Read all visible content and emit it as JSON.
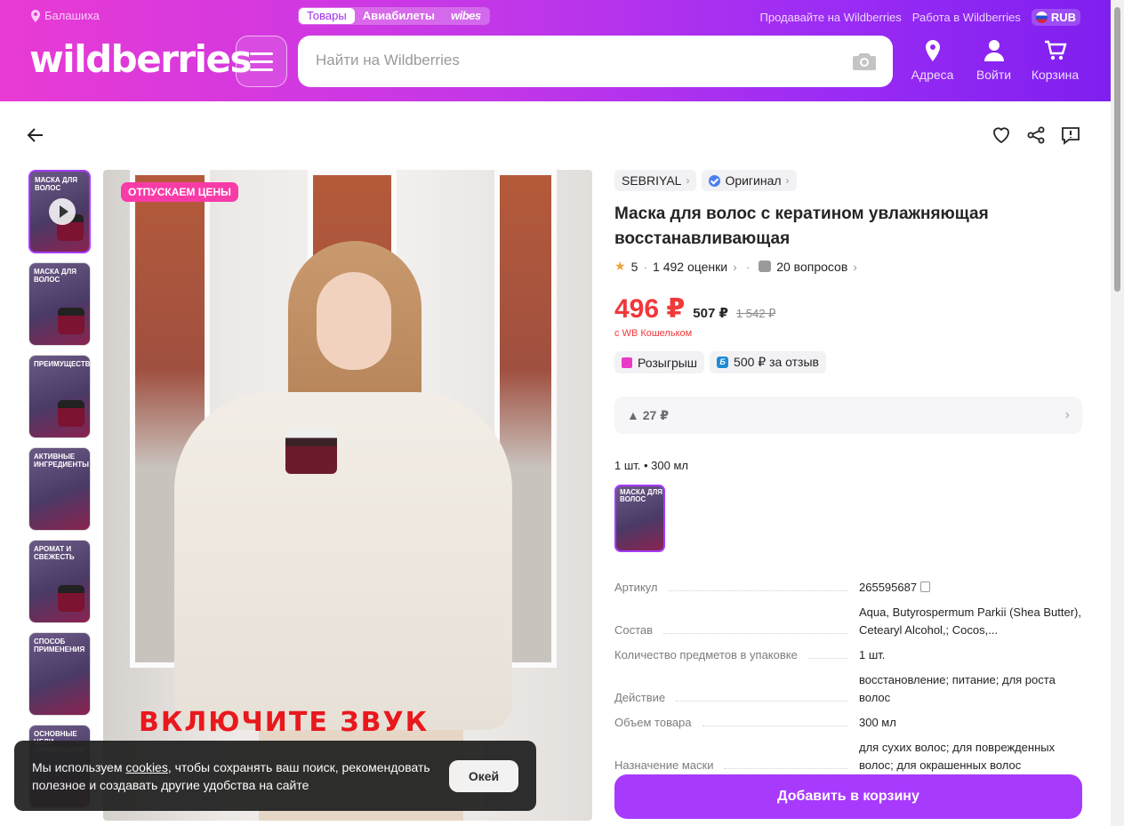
{
  "header": {
    "location": "Балашиха",
    "tabs": [
      "Товары",
      "Авиабилеты",
      "wibes"
    ],
    "sell_link": "Продавайте на Wildberries",
    "job_link": "Работа в Wildberries",
    "currency": "RUB",
    "logo": "wildberries",
    "search_placeholder": "Найти на Wildberries",
    "nav": {
      "addresses": "Адреса",
      "login": "Войти",
      "cart": "Корзина"
    }
  },
  "gallery": {
    "promo_label": "ОТПУСКАЕМ ЦЕНЫ",
    "sound_overlay": "ВКЛЮЧИТЕ ЗВУК",
    "thumbnails": [
      {
        "caption": "МАСКА ДЛЯ ВОЛОС",
        "video": true
      },
      {
        "caption": "МАСКА ДЛЯ ВОЛОС",
        "video": false
      },
      {
        "caption": "ПРЕИМУЩЕСТВА",
        "video": false
      },
      {
        "caption": "АКТИВНЫЕ ИНГРЕДИЕНТЫ",
        "video": false
      },
      {
        "caption": "АРОМАТ И СВЕЖЕСТЬ",
        "video": false
      },
      {
        "caption": "СПОСОБ ПРИМЕНЕНИЯ",
        "video": false
      },
      {
        "caption": "ОСНОВНЫЕ ЦЕЛИ ПРИМЕНЕНИЯ",
        "video": false
      }
    ]
  },
  "product": {
    "brand": "SEBRIYAL",
    "original": "Оригинал",
    "title": "Маска для волос с кератином увлажняющая восстанавливающая",
    "rating": "5",
    "reviews": "1 492 оценки",
    "questions": "20 вопросов",
    "price": "496 ₽",
    "price_no_wallet": "507 ₽",
    "old_price": "1 542 ₽",
    "wallet_note": "с WB Кошельком",
    "badge_lottery": "Розыгрыш",
    "badge_review": "500 ₽ за отзыв",
    "price_delta": "▲ 27 ₽",
    "pack_info": "1 шт. • 300 мл",
    "variant_caption": "МАСКА ДЛЯ ВОЛОС",
    "specs": [
      {
        "key": "Артикул",
        "value": "265595687"
      },
      {
        "key": "Состав",
        "value": "Aqua, Butyrospermum Parkii (Shea Butter), Cetearyl Alcohol,; Cocos,..."
      },
      {
        "key": "Количество предметов в упаковке",
        "value": "1 шт."
      },
      {
        "key": "Действие",
        "value": "восстановление; питание; для роста волос"
      },
      {
        "key": "Объем товара",
        "value": "300 мл"
      },
      {
        "key": "Назначение маски",
        "value": "для сухих волос; для поврежденных волос; для окрашенных волос"
      }
    ],
    "add_to_cart": "Добавить в корзину"
  },
  "cookie": {
    "text_before": "Мы используем ",
    "link": "cookies",
    "text_after": ", чтобы сохранять ваш поиск, рекомендовать полезное и создавать другие удобства на сайте",
    "ok": "Окей"
  },
  "colors": {
    "accent": "#a73afd",
    "price": "#f1383a",
    "promo": "#f93ba8"
  }
}
